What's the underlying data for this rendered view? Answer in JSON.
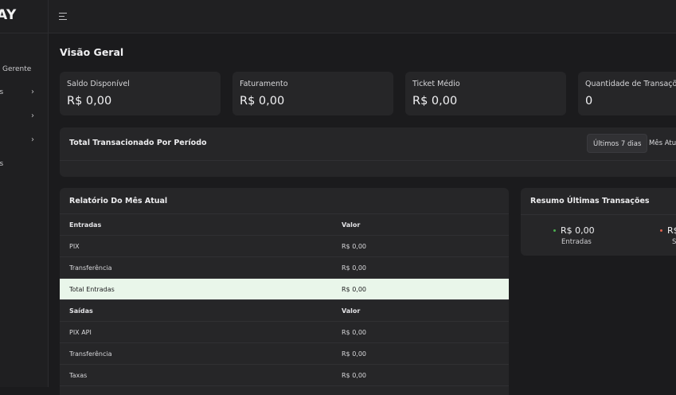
{
  "brand": {
    "text": "AY"
  },
  "sidebar": {
    "items": [
      {
        "label": "Gerente",
        "chevron": false
      },
      {
        "label": "as",
        "chevron": true
      },
      {
        "label": "",
        "chevron": true
      },
      {
        "label": "",
        "chevron": true
      },
      {
        "label": "es",
        "chevron": false
      }
    ]
  },
  "topbar": {
    "menu_icon": "hamburger-menu-icon"
  },
  "page": {
    "title": "Visão Geral"
  },
  "stats": [
    {
      "label": "Saldo Disponível",
      "value": "R$ 0,00"
    },
    {
      "label": "Faturamento",
      "value": "R$ 0,00"
    },
    {
      "label": "Ticket Médio",
      "value": "R$ 0,00"
    },
    {
      "label": "Quantidade de Transaçõe",
      "value": "0"
    }
  ],
  "period": {
    "title": "Total Transacionado Por Período",
    "buttons": [
      {
        "label": "Últimos 7 dias",
        "active": true
      },
      {
        "label": "Mês Atual",
        "active": false
      }
    ]
  },
  "report": {
    "title": "Relatório Do Mês Atual",
    "rows": [
      {
        "c1": "Entradas",
        "c2": "Valor",
        "kind": "head"
      },
      {
        "c1": "PIX",
        "c2": "R$ 0,00",
        "kind": "row"
      },
      {
        "c1": "Transferência",
        "c2": "R$ 0,00",
        "kind": "row"
      },
      {
        "c1": "Total Entradas",
        "c2": "R$ 0,00",
        "kind": "total"
      },
      {
        "c1": "Saídas",
        "c2": "Valor",
        "kind": "head"
      },
      {
        "c1": "PIX API",
        "c2": "R$ 0,00",
        "kind": "row"
      },
      {
        "c1": "Transferência",
        "c2": "R$ 0,00",
        "kind": "row"
      },
      {
        "c1": "Taxas",
        "c2": "R$ 0,00",
        "kind": "row"
      }
    ]
  },
  "summary": {
    "title": "Resumo Últimas Transações",
    "items": [
      {
        "value": "R$ 0,00",
        "label": "Entradas",
        "dot_color": "#4caf50"
      },
      {
        "value": "R$",
        "label": "S",
        "dot_color": "#e0624f"
      }
    ]
  },
  "colors": {
    "background": "#1b1b1d",
    "card": "#262628",
    "total_row": "#e9f6ea"
  }
}
